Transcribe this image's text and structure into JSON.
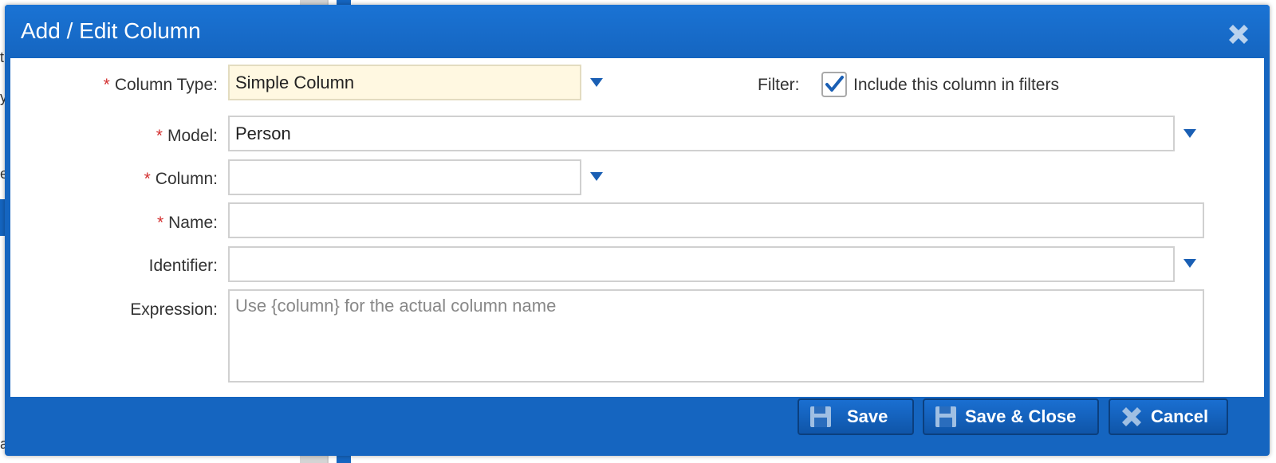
{
  "background": {
    "fragments": [
      "t",
      "y",
      "e",
      "ataset"
    ]
  },
  "dialog": {
    "title": "Add / Edit Column",
    "close_icon": "close-x-icon",
    "accent": "#1565c0"
  },
  "form": {
    "required_marker": "*",
    "column_type": {
      "label": "Column Type:",
      "value": "Simple Column"
    },
    "filter": {
      "label": "Filter:",
      "checked": true,
      "checkbox_label": "Include this column in filters"
    },
    "model": {
      "label": "Model:",
      "value": "Person"
    },
    "column": {
      "label": "Column:",
      "value": ""
    },
    "name": {
      "label": "Name:",
      "value": ""
    },
    "identifier": {
      "label": "Identifier:",
      "value": ""
    },
    "expression": {
      "label": "Expression:",
      "value": "",
      "placeholder": "Use {column} for the actual column name"
    }
  },
  "footer": {
    "save_label": "Save",
    "save_close_label": "Save & Close",
    "cancel_label": "Cancel"
  }
}
